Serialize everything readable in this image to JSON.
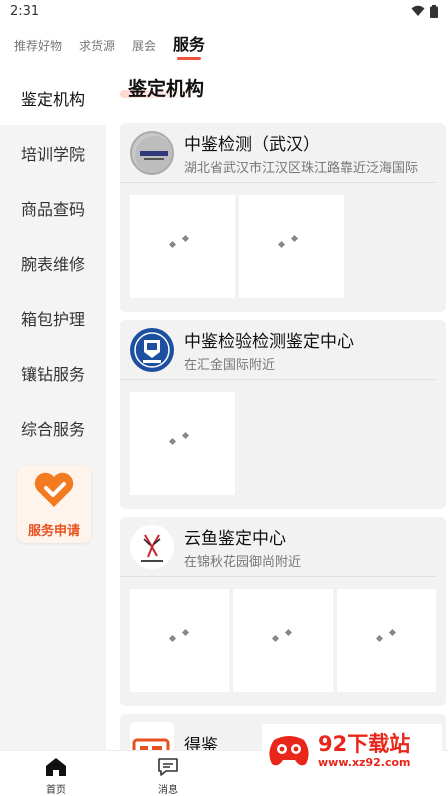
{
  "status": {
    "time": "2:31"
  },
  "top_tabs": [
    {
      "label": "推荐好物"
    },
    {
      "label": "求货源"
    },
    {
      "label": "展会"
    },
    {
      "label": "服务"
    }
  ],
  "sidebar": {
    "items": [
      {
        "label": "鉴定机构"
      },
      {
        "label": "培训学院"
      },
      {
        "label": "商品查码"
      },
      {
        "label": "腕表维修"
      },
      {
        "label": "箱包护理"
      },
      {
        "label": "镶钻服务"
      },
      {
        "label": "综合服务"
      }
    ],
    "service_button": "服务申请"
  },
  "main": {
    "title": "鉴定机构",
    "cards": [
      {
        "name": "中鉴检测（武汉）",
        "address": "湖北省武汉市江汉区珠江路靠近泛海国际"
      },
      {
        "name": "中鉴检验检测鉴定中心",
        "address": "在汇金国际附近"
      },
      {
        "name": "云鱼鉴定中心",
        "address": "在锦秋花园御尚附近"
      },
      {
        "name": "得鉴",
        "address": ""
      }
    ]
  },
  "bottom_nav": [
    {
      "label": "首页",
      "icon": "home-icon"
    },
    {
      "label": "消息",
      "icon": "message-icon"
    }
  ],
  "watermark": {
    "title": "92下载站",
    "url": "www.xz92.com"
  },
  "colors": {
    "accent": "#f0533a",
    "service_orange": "#e8511e",
    "watermark_red": "#e8261a"
  }
}
